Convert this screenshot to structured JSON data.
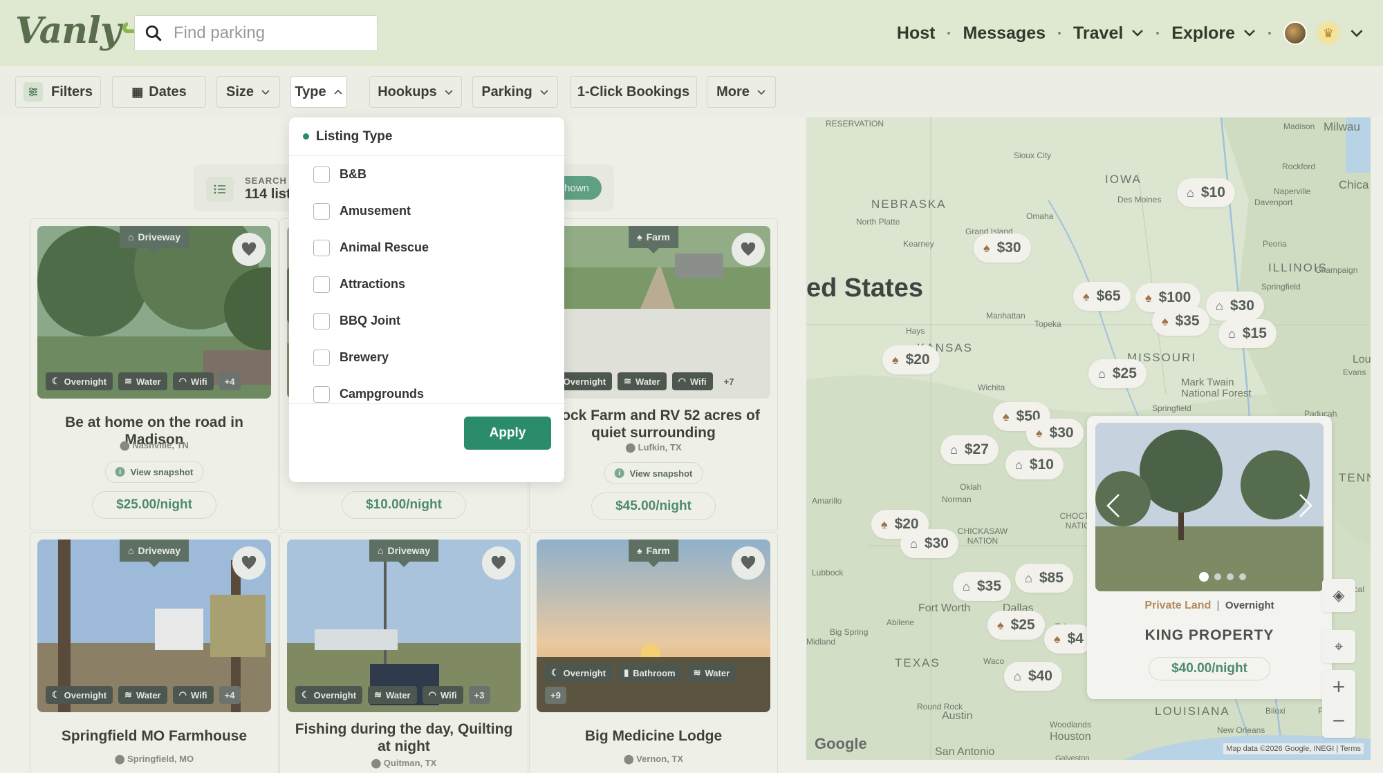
{
  "header": {
    "logo": "Vanly",
    "search_placeholder": "Find parking",
    "nav": {
      "host": "Host",
      "messages": "Messages",
      "travel": "Travel",
      "explore": "Explore"
    }
  },
  "filters": {
    "filters": "Filters",
    "dates": "Dates",
    "size": "Size",
    "type": "Type",
    "hookups": "Hookups",
    "parking": "Parking",
    "one_click": "1-Click Bookings",
    "more": "More"
  },
  "results": {
    "label": "SEARCH",
    "count": "114 list",
    "pill": "hown"
  },
  "dropdown": {
    "title": "Listing Type",
    "options": [
      "B&B",
      "Amusement",
      "Animal Rescue",
      "Attractions",
      "BBQ Joint",
      "Brewery",
      "Campgrounds"
    ],
    "apply": "Apply"
  },
  "cards": [
    {
      "tag": "Driveway",
      "amenities": [
        "Overnight",
        "Water",
        "Wifi"
      ],
      "more": "+4",
      "title": "Be at home on the road in Madison",
      "location": "Nashville, TN",
      "snapshot": "View snapshot",
      "price": "$25.00/night"
    },
    {
      "price": "$10.00/night"
    },
    {
      "tag": "Farm",
      "amenities": [
        "Overnight",
        "Water",
        "Wifi"
      ],
      "more": "+7",
      "title": "hrock Farm and RV 52 acres of quiet surrounding",
      "location": "Lufkin, TX",
      "snapshot": "View snapshot",
      "price": "$45.00/night"
    },
    {
      "tag": "Driveway",
      "amenities": [
        "Overnight",
        "Water",
        "Wifi"
      ],
      "more": "+4",
      "title": "Springfield MO Farmhouse",
      "location": "Springfield, MO"
    },
    {
      "tag": "Driveway",
      "amenities": [
        "Overnight",
        "Water",
        "Wifi"
      ],
      "more": "+3",
      "title": "Fishing during the day, Quilting at night",
      "location": "Quitman, TX"
    },
    {
      "tag": "Farm",
      "amenities": [
        "Overnight",
        "Bathroom",
        "Water"
      ],
      "more": "+9",
      "title": "Big Medicine Lodge",
      "location": "Vernon, TX"
    }
  ],
  "map": {
    "country": "ed States",
    "states": [
      "NEBRASKA",
      "IOWA",
      "ILLINOIS",
      "KANSAS",
      "MISSOURI",
      "TEXAS",
      "LOUISIANA",
      "TENN",
      "CHOCTAW NATION",
      "CHICKASAW NATION",
      "RESERVATION"
    ],
    "cities": [
      "Sioux City",
      "Omaha",
      "Des Moines",
      "Grand Island",
      "Kearney",
      "North Platte",
      "Peoria",
      "Springfield",
      "Champaign",
      "Rockford",
      "Naperville",
      "Madison",
      "Milwau",
      "Chica",
      "Davenport",
      "Manhattan",
      "Topeka",
      "Hays",
      "Wichita",
      "Springfield",
      "Amarillo",
      "Norman",
      "Lubbock",
      "Fort Worth",
      "Dallas",
      "Abilene",
      "Tyler",
      "Big Spring",
      "Midland",
      "Waco",
      "Round Rock",
      "Austin",
      "Houston",
      "San Antonio",
      "Woodlands",
      "Galveston",
      "New Orleans",
      "Biloxi",
      "Pens",
      "Lou",
      "Evans",
      "Tuscal",
      "Paducah",
      "Mark Twain National Forest",
      "Oklah"
    ],
    "pins": [
      "$10",
      "$30",
      "$65",
      "$100",
      "$30",
      "$35",
      "$15",
      "$20",
      "$25",
      "$50",
      "$30",
      "$27",
      "$10",
      "$20",
      "$30",
      "$35",
      "$85",
      "$25",
      "$4",
      "$40"
    ],
    "card": {
      "place": "Private Land",
      "stay": "Overnight",
      "title": "KING PROPERTY",
      "price": "$40.00/night"
    },
    "google": "Google",
    "attribution": "Map data ©2026 Google, INEGI",
    "terms": "Terms"
  }
}
